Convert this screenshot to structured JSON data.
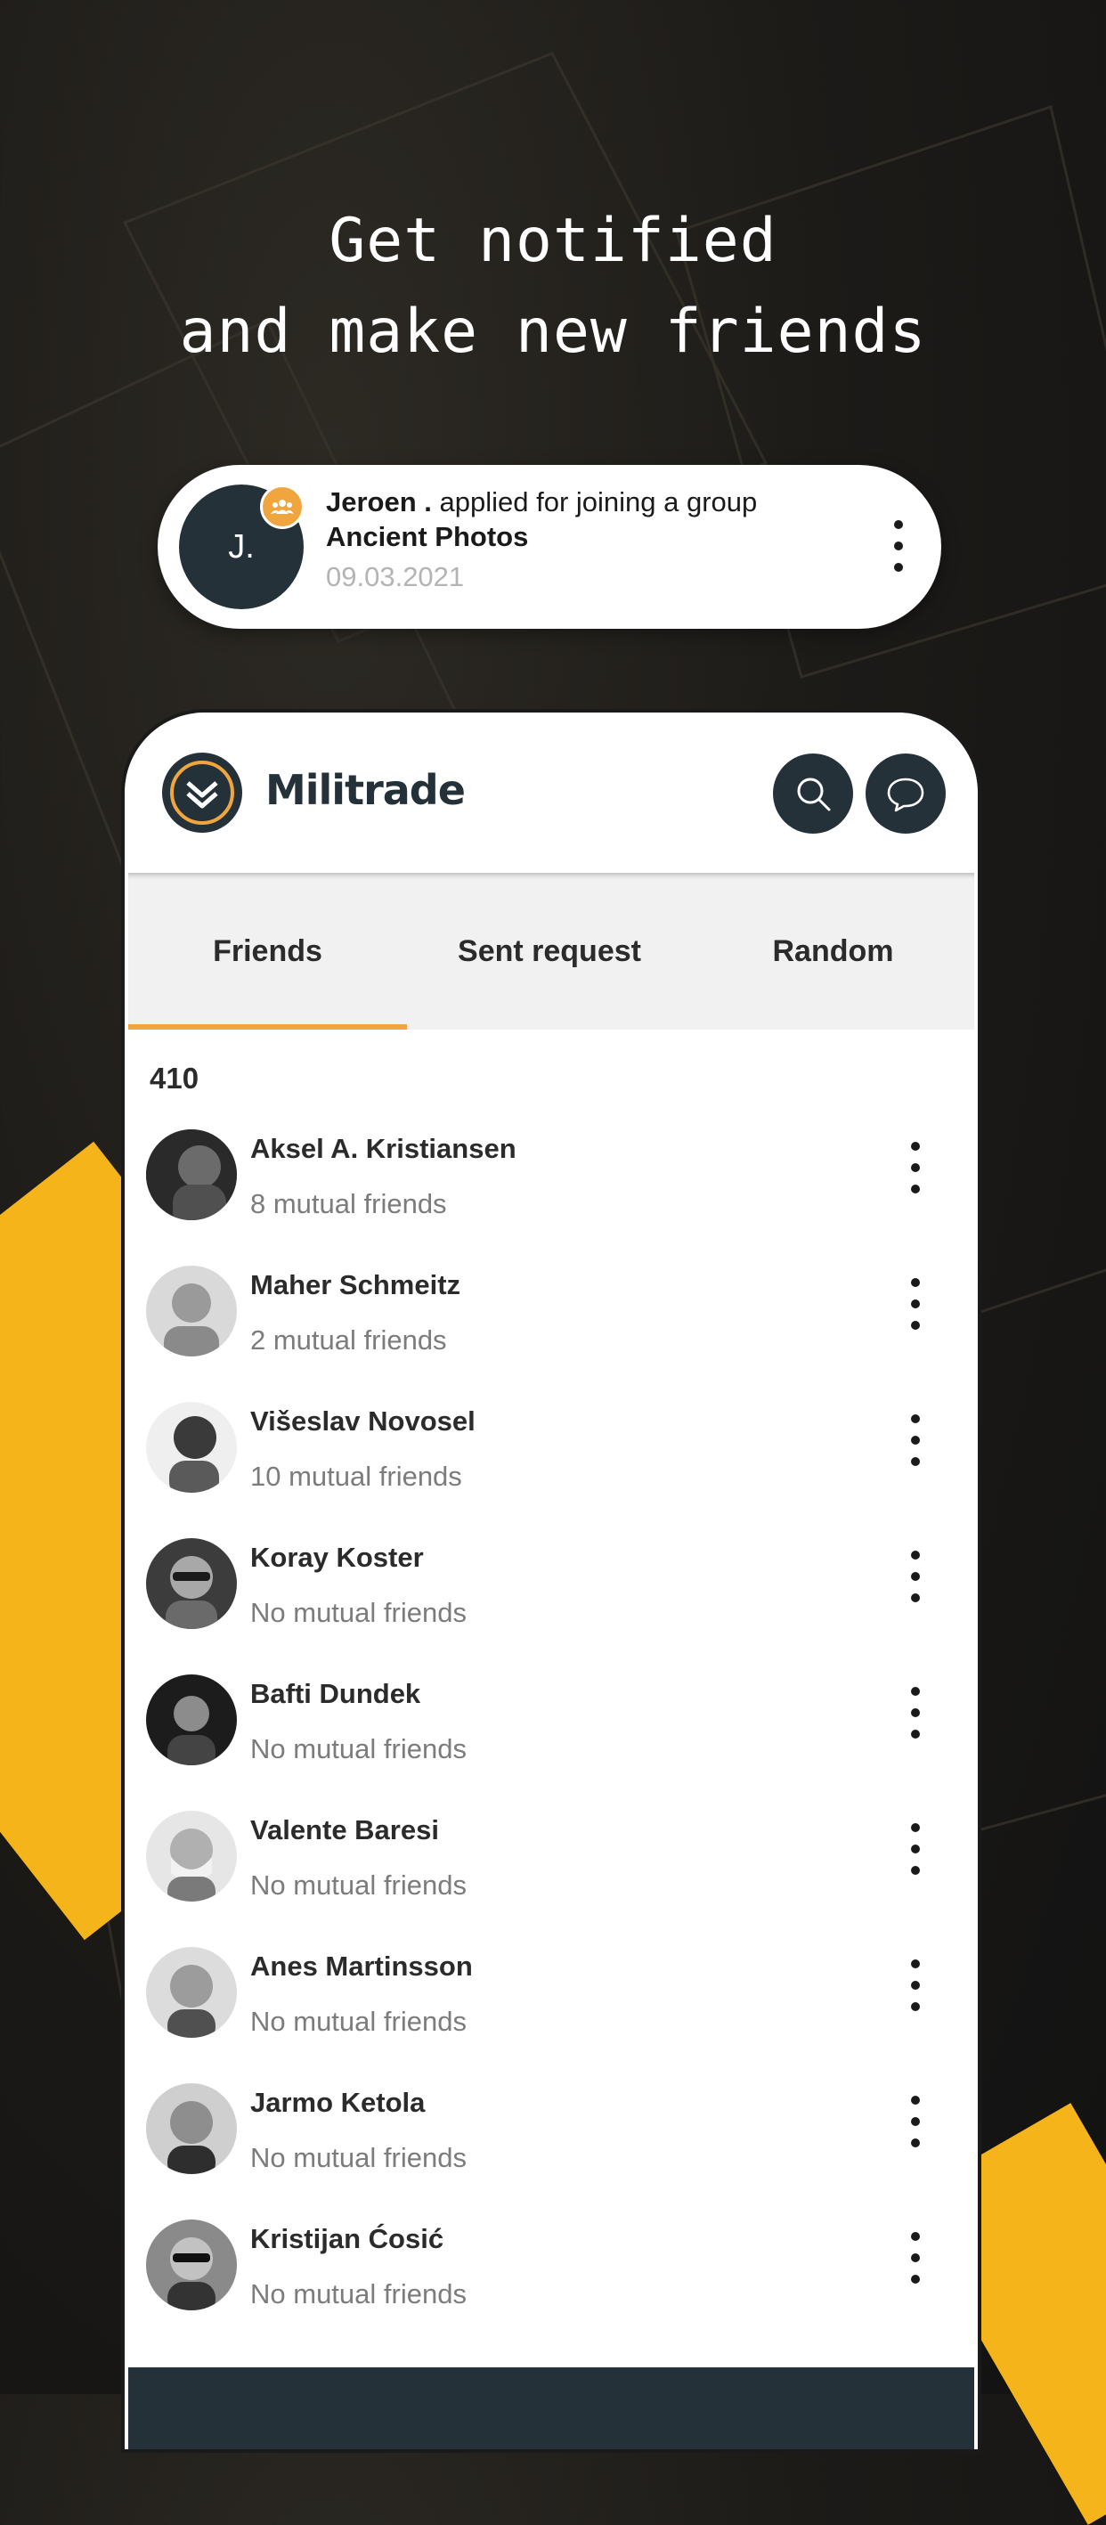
{
  "headline": {
    "line1": "Get notified",
    "line2": "and make new friends"
  },
  "notification": {
    "avatar_initial": "J.",
    "actor": "Jeroen .",
    "action": "applied for joining a group",
    "group": "Ancient Photos",
    "date": "09.03.2021",
    "badge_icon": "group-icon",
    "more_icon": "more-vertical-icon"
  },
  "app": {
    "title": "Militrade",
    "logo_icon": "chevron-double-down-icon",
    "search_icon": "search-icon",
    "chat_icon": "chat-bubble-icon"
  },
  "tabs": [
    {
      "label": "Friends",
      "active": true
    },
    {
      "label": "Sent request",
      "active": false
    },
    {
      "label": "Random",
      "active": false
    }
  ],
  "friends_count": "410",
  "friends": [
    {
      "name": "Aksel A. Kristiansen",
      "mutual": "8 mutual friends"
    },
    {
      "name": "Maher Schmeitz",
      "mutual": "2 mutual friends"
    },
    {
      "name": "Višeslav Novosel",
      "mutual": "10 mutual friends"
    },
    {
      "name": "Koray Koster",
      "mutual": "No mutual friends"
    },
    {
      "name": "Bafti Dundek",
      "mutual": "No mutual friends"
    },
    {
      "name": "Valente Baresi",
      "mutual": "No mutual friends"
    },
    {
      "name": "Anes Martinsson",
      "mutual": "No mutual friends"
    },
    {
      "name": "Jarmo Ketola",
      "mutual": "No mutual friends"
    },
    {
      "name": "Kristijan Ćosić",
      "mutual": "No mutual friends"
    }
  ],
  "colors": {
    "accent": "#f0a53e",
    "dark": "#243139",
    "yellow": "#f4b41a"
  }
}
